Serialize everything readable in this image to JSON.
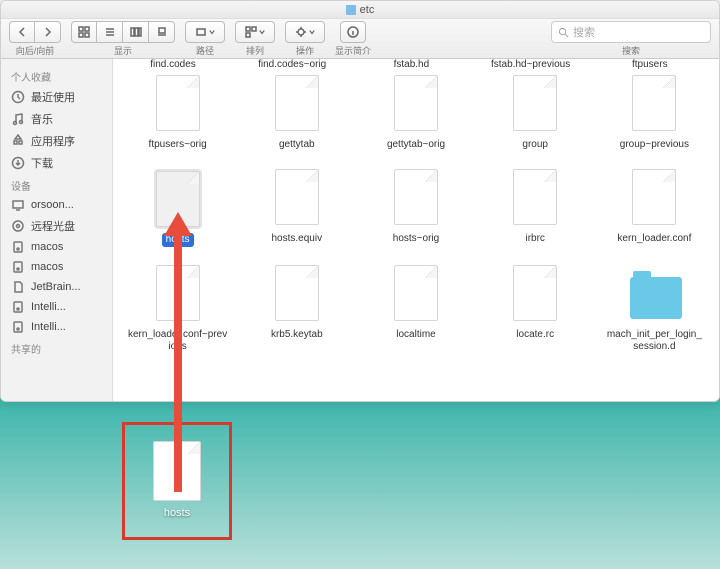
{
  "window": {
    "title": "etc",
    "nav_label": "向后/向前",
    "view_label": "显示",
    "path_label": "路径",
    "sort_label": "排列",
    "action_label": "操作",
    "info_label": "显示简介",
    "search_placeholder": "搜索",
    "search_label": "搜索"
  },
  "sidebar": {
    "favorites_header": "个人收藏",
    "favorites": [
      {
        "label": "最近使用",
        "icon": "clock"
      },
      {
        "label": "音乐",
        "icon": "music"
      },
      {
        "label": "应用程序",
        "icon": "apps"
      },
      {
        "label": "下载",
        "icon": "download"
      }
    ],
    "devices_header": "设备",
    "devices": [
      {
        "label": "orsoon...",
        "icon": "monitor"
      },
      {
        "label": "远程光盘",
        "icon": "disc"
      },
      {
        "label": "macos",
        "icon": "disk"
      },
      {
        "label": "macos",
        "icon": "disk"
      },
      {
        "label": "JetBrain...",
        "icon": "doc"
      },
      {
        "label": "Intelli...",
        "icon": "disk"
      },
      {
        "label": "Intelli...",
        "icon": "disk"
      }
    ],
    "shared_header": "共享的"
  },
  "partial_row": [
    "find.codes",
    "find.codes~orig",
    "fstab.hd",
    "fstab.hd~previous",
    "ftpusers"
  ],
  "files": [
    {
      "name": "ftpusers~orig",
      "type": "doc"
    },
    {
      "name": "gettytab",
      "type": "doc"
    },
    {
      "name": "gettytab~orig",
      "type": "doc"
    },
    {
      "name": "group",
      "type": "doc"
    },
    {
      "name": "group~previous",
      "type": "doc"
    },
    {
      "name": "hosts",
      "type": "doc",
      "selected": true
    },
    {
      "name": "hosts.equiv",
      "type": "doc"
    },
    {
      "name": "hosts~orig",
      "type": "doc"
    },
    {
      "name": "irbrc",
      "type": "doc"
    },
    {
      "name": "kern_loader.conf",
      "type": "doc"
    },
    {
      "name": "kern_loader.conf~previous",
      "type": "doc"
    },
    {
      "name": "krb5.keytab",
      "type": "doc"
    },
    {
      "name": "localtime",
      "type": "doc"
    },
    {
      "name": "locate.rc",
      "type": "doc"
    },
    {
      "name": "mach_init_per_login_session.d",
      "type": "folder"
    }
  ],
  "desktop_file": {
    "name": "hosts"
  }
}
